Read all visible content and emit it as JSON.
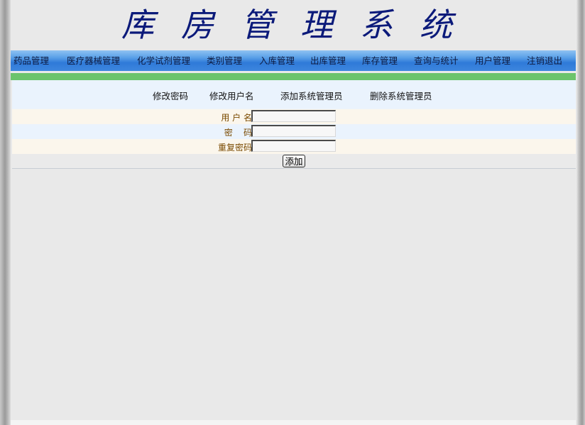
{
  "header": {
    "title": "库房管理系统"
  },
  "nav": {
    "items": [
      {
        "id": "drugs",
        "label": "药品管理"
      },
      {
        "id": "devices",
        "label": "医疗器械管理"
      },
      {
        "id": "reagents",
        "label": "化学试剂管理"
      },
      {
        "id": "categories",
        "label": "类别管理"
      },
      {
        "id": "inbound",
        "label": "入库管理"
      },
      {
        "id": "outbound",
        "label": "出库管理"
      },
      {
        "id": "stock",
        "label": "库存管理"
      },
      {
        "id": "query",
        "label": "查询与统计"
      },
      {
        "id": "users",
        "label": "用户管理"
      },
      {
        "id": "logout",
        "label": "注销退出"
      }
    ]
  },
  "user_tabs": {
    "change_password": "修改密码",
    "change_username": "修改用户名",
    "add_admin": "添加系统管理员",
    "delete_admin": "删除系统管理员"
  },
  "form": {
    "username_label": "用 户 名:",
    "password_label": "密    码:",
    "repeat_password_label": "重复密码:",
    "username_value": "",
    "password_value": "",
    "repeat_password_value": "",
    "submit_label": "添加"
  },
  "colors": {
    "title": "#0b1a7a",
    "nav_blue": "#3d86de",
    "green_bar": "#6cc46c",
    "label_brown": "#7a4a00"
  }
}
